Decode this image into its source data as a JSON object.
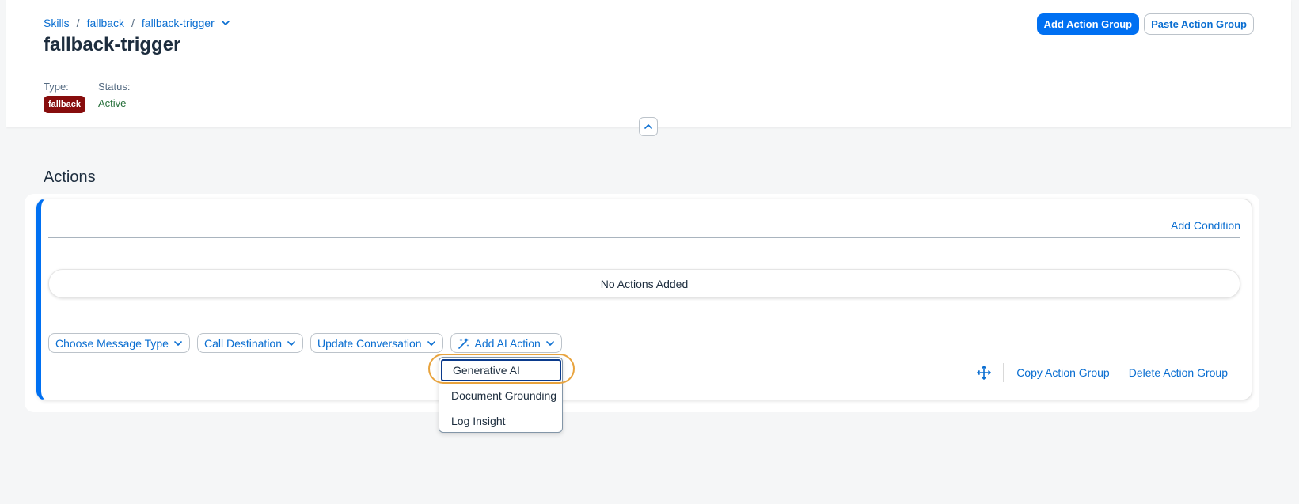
{
  "breadcrumb": {
    "items": [
      "Skills",
      "fallback",
      "fallback-trigger"
    ],
    "sep": "/"
  },
  "page": {
    "title": "fallback-trigger"
  },
  "meta": {
    "type_label": "Type:",
    "type_value": "fallback",
    "status_label": "Status:",
    "status_value": "Active"
  },
  "header_actions": {
    "add_action_group": "Add Action Group",
    "paste_action_group": "Paste Action Group"
  },
  "section": {
    "title": "Actions"
  },
  "group": {
    "add_condition": "Add Condition",
    "empty_text": "No Actions Added",
    "menus": [
      "Choose Message Type",
      "Call Destination",
      "Update Conversation",
      "Add AI Action"
    ],
    "copy_action_group": "Copy Action Group",
    "delete_action_group": "Delete Action Group"
  },
  "dropdown": {
    "items": [
      "Generative AI",
      "Document Grounding",
      "Log Insight"
    ],
    "focused_index": 0
  },
  "colors": {
    "accent": "#0070f2",
    "link": "#0a6ed1",
    "badge": "#870d0d",
    "status_active": "#256f3a",
    "highlight": "#e8a33d"
  },
  "icons": [
    "chevron-down-icon",
    "chevron-up-icon",
    "ai-sparkle-icon",
    "move-icon"
  ]
}
